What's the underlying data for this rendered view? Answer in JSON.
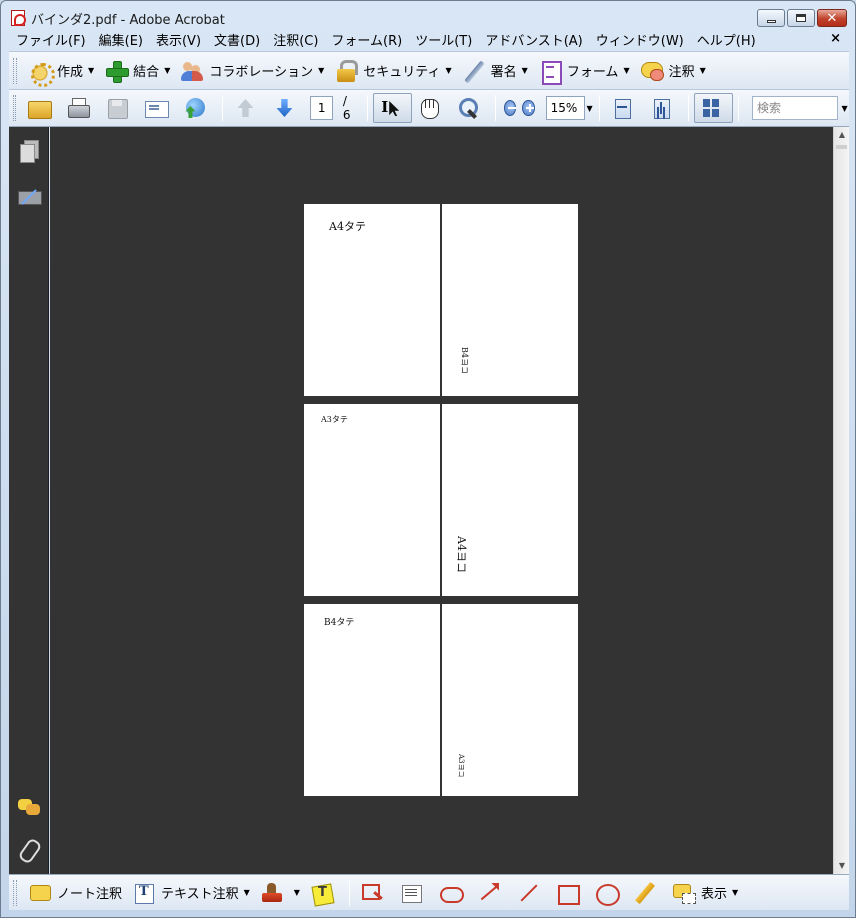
{
  "window": {
    "title": "バインダ2.pdf - Adobe Acrobat"
  },
  "menubar": {
    "items": [
      "ファイル(F)",
      "編集(E)",
      "表示(V)",
      "文書(D)",
      "注釈(C)",
      "フォーム(R)",
      "ツール(T)",
      "アドバンスト(A)",
      "ウィンドウ(W)",
      "ヘルプ(H)"
    ],
    "close_glyph": "×"
  },
  "tasks_toolbar": {
    "create": "作成",
    "combine": "結合",
    "collaborate": "コラボレーション",
    "security": "セキュリティ",
    "sign": "署名",
    "forms": "フォーム",
    "comment": "注釈"
  },
  "file_toolbar": {
    "current_page": "1",
    "total_pages": "/ 6",
    "zoom": "15%",
    "search_placeholder": "検索"
  },
  "document": {
    "pages": [
      {
        "label": "A4タテ"
      },
      {
        "label": "B4ヨコ"
      },
      {
        "label": "A3タテ"
      },
      {
        "label": "A4ヨコ"
      },
      {
        "label": "B4タテ"
      },
      {
        "label": "A3ヨコ"
      }
    ]
  },
  "comment_toolbar": {
    "sticky_note": "ノート注釈",
    "text_edits": "テキスト注釈",
    "show": "表示"
  }
}
